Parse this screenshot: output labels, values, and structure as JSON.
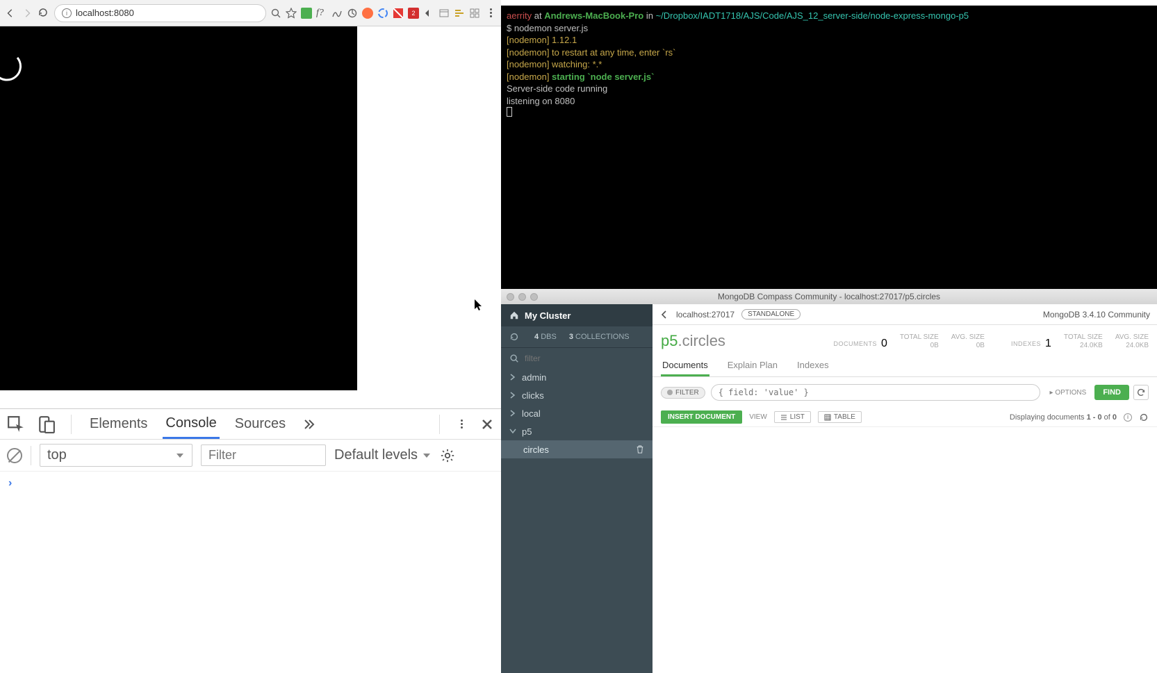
{
  "browser": {
    "url": "localhost:8080",
    "devtools": {
      "tabs": {
        "elements": "Elements",
        "console": "Console",
        "sources": "Sources"
      },
      "context": "top",
      "filter_placeholder": "Filter",
      "levels": "Default levels"
    }
  },
  "terminal": {
    "line1_user": "aerrity",
    "line1_at": " at ",
    "line1_host": "Andrews-MacBook-Pro",
    "line1_in": " in ",
    "line1_path": "~/Dropbox/IADT1718/AJS/Code/AJS_12_server-side/node-express-mongo-p5",
    "line2": "$ nodemon server.js",
    "line3": "[nodemon] 1.12.1",
    "line4": "[nodemon] to restart at any time, enter `rs`",
    "line5": "[nodemon] watching: *.*",
    "line6_a": "[nodemon] ",
    "line6_b": "starting `node server.js`",
    "line7": "Server-side code running",
    "line8": "listening on 8080"
  },
  "compass": {
    "title": "MongoDB Compass Community - localhost:27017/p5.circles",
    "cluster": "My Cluster",
    "dbs_count": "4",
    "dbs_label": "DBS",
    "coll_count": "3",
    "coll_label": "COLLECTIONS",
    "filter_placeholder": "filter",
    "dbs": [
      "admin",
      "clicks",
      "local",
      "p5"
    ],
    "collection": "circles",
    "top": {
      "host": "localhost:27017",
      "mode": "STANDALONE",
      "version": "MongoDB 3.4.10 Community"
    },
    "ns": {
      "db": "p5",
      "coll": ".circles"
    },
    "stats": {
      "documents_label": "DOCUMENTS",
      "documents": "0",
      "total_size_label": "TOTAL SIZE",
      "total_size": "0B",
      "avg_size_label": "AVG. SIZE",
      "avg_size": "0B",
      "indexes_label": "INDEXES",
      "indexes": "1",
      "idx_total_size": "24.0KB",
      "idx_avg_size": "24.0KB"
    },
    "tabs": {
      "documents": "Documents",
      "explain": "Explain Plan",
      "indexes": "Indexes"
    },
    "filter": {
      "label": "FILTER",
      "placeholder": "{ field: 'value' }",
      "options": "OPTIONS",
      "find": "FIND"
    },
    "actions": {
      "insert": "INSERT DOCUMENT",
      "view": "VIEW",
      "list": "LIST",
      "table": "TABLE",
      "display_prefix": "Displaying documents ",
      "display_range": "1 - 0",
      "display_of": " of ",
      "display_total": "0"
    }
  }
}
